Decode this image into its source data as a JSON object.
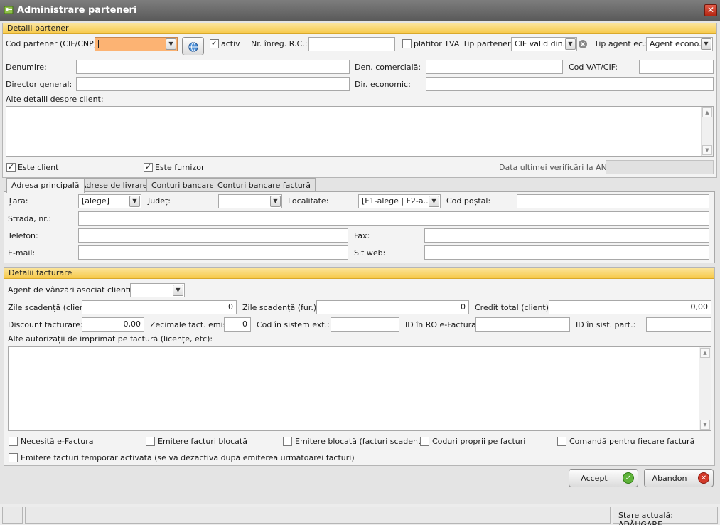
{
  "window": {
    "title": "Administrare parteneri",
    "close_glyph": "✕"
  },
  "partner": {
    "header": "Detalii partener",
    "cod_label": "Cod partener (CIF/CNP):",
    "activ_label": "activ",
    "nr_reg_label": "Nr. înreg. R.C.:",
    "platitor_label": "plătitor TVA",
    "tip_partener_label": "Tip partener:",
    "tip_partener_value": "CIF valid din...",
    "tip_agent_label": "Tip agent ec.:",
    "tip_agent_value": "Agent econo...",
    "denumire_label": "Denumire:",
    "den_comerciala_label": "Den. comercială:",
    "cod_vat_label": "Cod VAT/CIF:",
    "director_label": "Director general:",
    "dir_economic_label": "Dir. economic:",
    "alte_detalii_label": "Alte detalii despre client:",
    "este_client_label": "Este client",
    "este_furnizor_label": "Este furnizor",
    "anaf_label": "Data ultimei verificări la ANAF:"
  },
  "tabs": [
    {
      "label": "Adresa principală"
    },
    {
      "label": "Adrese de livrare"
    },
    {
      "label": "Conturi bancare"
    },
    {
      "label": "Conturi bancare factură"
    }
  ],
  "address": {
    "tara_label": "Țara:",
    "tara_value": "[alege]",
    "judet_label": "Județ:",
    "localitate_label": "Localitate:",
    "localitate_value": "[F1-alege | F2-a...",
    "cod_postal_label": "Cod poștal:",
    "strada_label": "Strada, nr.:",
    "telefon_label": "Telefon:",
    "fax_label": "Fax:",
    "email_label": "E-mail:",
    "site_label": "Sit web:"
  },
  "billing": {
    "header": "Detalii facturare",
    "agent_label": "Agent de vânzări asociat clientului:",
    "zile_client_label": "Zile scadență (client)",
    "zile_client_value": "0",
    "zile_fur_label": "Zile scadență (fur.):",
    "zile_fur_value": "0",
    "credit_label": "Credit total (client):",
    "credit_value": "0,00",
    "discount_label": "Discount facturare:",
    "discount_value": "0,00",
    "zecimale_label": "Zecimale fact. emise:",
    "zecimale_value": "0",
    "cod_sistem_label": "Cod în sistem ext.:",
    "id_ro_label": "ID în RO e-Factura:",
    "id_sist_label": "ID în sist. part.:",
    "alte_autorizatii_label": "Alte autorizații de imprimat pe factură (licențe, etc):",
    "chk_efactura": "Necesită e-Factura",
    "chk_blocata": "Emitere facturi blocată",
    "chk_scadente": "Emitere blocată (facturi scadente)",
    "chk_coduri": "Coduri proprii pe facturi",
    "chk_comanda": "Comandă pentru fiecare factură",
    "chk_temporar": "Emitere facturi temporar activată (se va dezactiva după emiterea următoarei facturi)"
  },
  "buttons": {
    "accept": "Accept",
    "abandon": "Abandon"
  },
  "status": {
    "text": "Stare actuală: ADĂUGARE"
  },
  "colors": {
    "accent": "#f7c94a",
    "orange_field": "#fcb373",
    "accept_icon": "#5fb33a",
    "abandon_icon": "#d23a2a"
  },
  "icons": {
    "title": "app-icon",
    "browse": "globe-search-icon",
    "clear": "clear-icon",
    "accept": "check-circle-icon",
    "abandon": "close-circle-icon"
  }
}
